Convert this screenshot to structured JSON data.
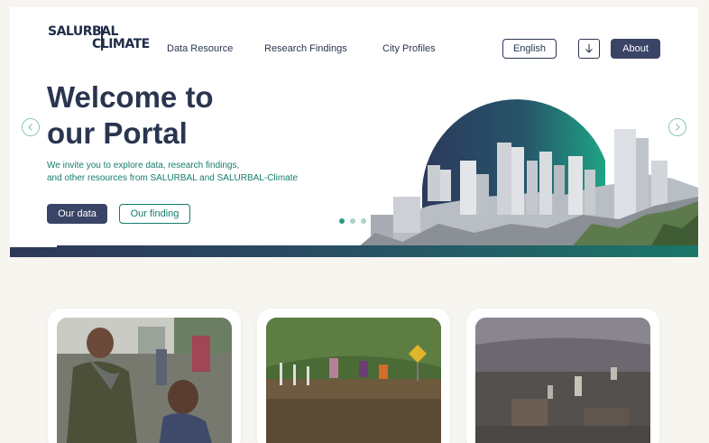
{
  "brand": {
    "logo_line1": "SALURBAL",
    "logo_line2": "CLIMATE"
  },
  "nav": {
    "items": [
      "Data Resource",
      "Research Findings",
      "City Profiles"
    ]
  },
  "header": {
    "language_label": "English",
    "download_icon": "download-icon",
    "about_label": "About"
  },
  "hero": {
    "title_line1": "Welcome to",
    "title_line2": "our Portal",
    "subtitle_line1": "We invite you to explore data, research findings,",
    "subtitle_line2": "and other resources from SALURBAL and SALURBAL-Climate",
    "primary_button": "Our data",
    "secondary_button": "Our finding",
    "carousel": {
      "slides": 3,
      "active": 1
    }
  },
  "cards": [
    {
      "image": "woman-and-child-market-photo"
    },
    {
      "image": "flooded-street-photo"
    },
    {
      "image": "aerial-city-photo"
    }
  ],
  "colors": {
    "navy": "#2a3550",
    "teal": "#147d6a",
    "button_dark": "#3a4466",
    "background": "#f7f5f0"
  }
}
